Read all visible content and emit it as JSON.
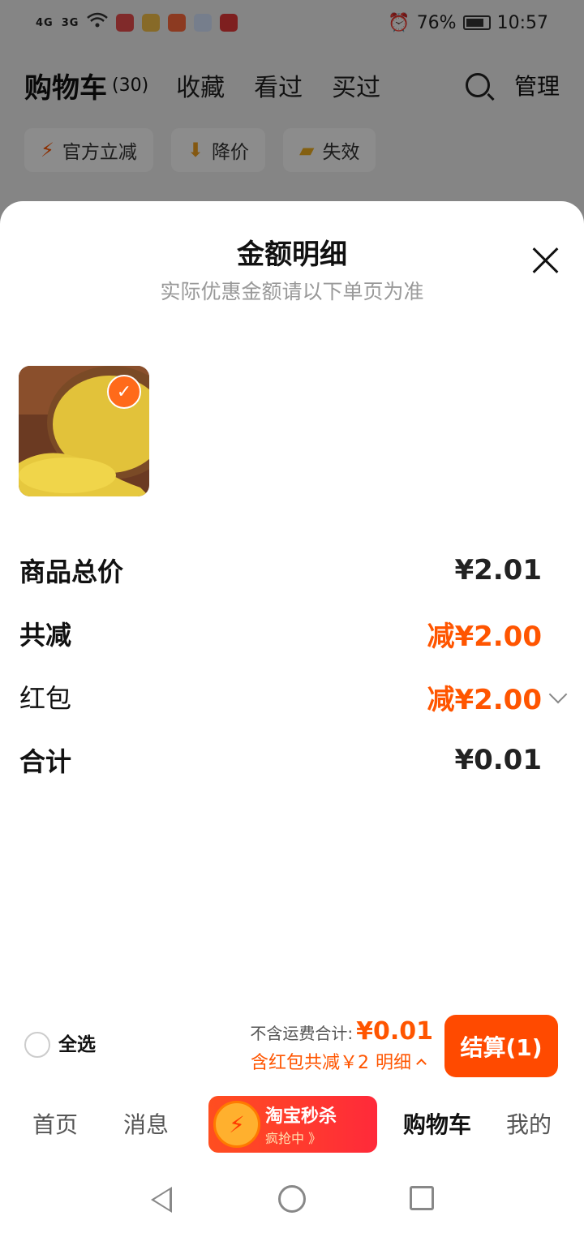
{
  "status_bar": {
    "signal_1": "4G",
    "signal_2": "3G",
    "battery_percent": "76%",
    "time": "10:57"
  },
  "background_page": {
    "title": "购物车",
    "count": "(30)",
    "tabs": [
      "收藏",
      "看过",
      "买过"
    ],
    "manage_label": "管理",
    "filters": [
      {
        "icon": "lightning-icon",
        "label": "官方立减"
      },
      {
        "icon": "price-drop-icon",
        "label": "降价"
      },
      {
        "icon": "invalid-icon",
        "label": "失效"
      }
    ]
  },
  "sheet": {
    "title": "金额明细",
    "subtitle": "实际优惠金额请以下单页为准",
    "rows": [
      {
        "label": "商品总价",
        "amount": "¥2.01"
      },
      {
        "label": "共减",
        "amount": "减¥2.00"
      },
      {
        "label": "红包",
        "amount": "减¥2.00"
      },
      {
        "label": "合计",
        "amount": "¥0.01"
      }
    ]
  },
  "action_bar": {
    "select_all": "全选",
    "total_label": "不含运费合计:",
    "total_value": "¥0.01",
    "promo_text": "含红包共减￥2",
    "detail_label": "明细",
    "checkout_label": "结算(1)"
  },
  "tabbar": {
    "home": "首页",
    "messages": "消息",
    "promo_title": "淘宝秒杀",
    "promo_sub": "疯抢中 》",
    "cart": "购物车",
    "mine": "我的"
  },
  "colors": {
    "accent": "#ff5500",
    "checkout_bg": "#ff4a00"
  }
}
